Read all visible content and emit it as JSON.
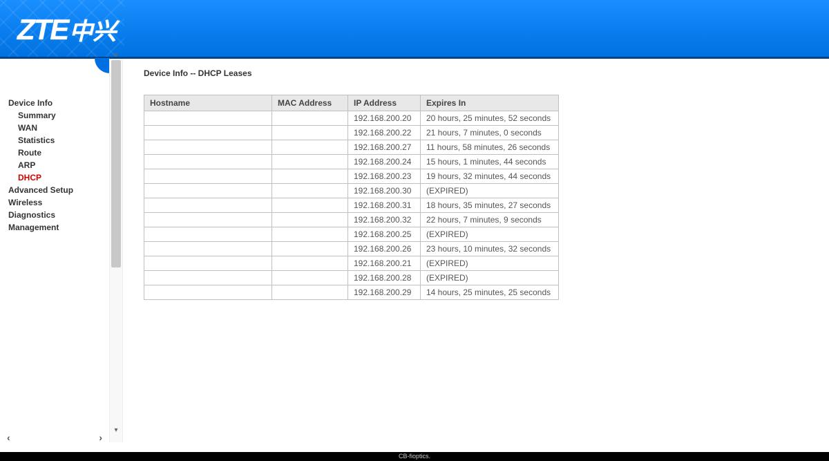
{
  "brand": {
    "logo_en": "ZTE",
    "logo_cn": "中兴"
  },
  "nav": {
    "items": [
      {
        "label": "Device Info",
        "sub": false,
        "active": false
      },
      {
        "label": "Summary",
        "sub": true,
        "active": false
      },
      {
        "label": "WAN",
        "sub": true,
        "active": false
      },
      {
        "label": "Statistics",
        "sub": true,
        "active": false
      },
      {
        "label": "Route",
        "sub": true,
        "active": false
      },
      {
        "label": "ARP",
        "sub": true,
        "active": false
      },
      {
        "label": "DHCP",
        "sub": true,
        "active": true
      },
      {
        "label": "Advanced Setup",
        "sub": false,
        "active": false
      },
      {
        "label": "Wireless",
        "sub": false,
        "active": false
      },
      {
        "label": "Diagnostics",
        "sub": false,
        "active": false
      },
      {
        "label": "Management",
        "sub": false,
        "active": false
      }
    ]
  },
  "page": {
    "title": "Device Info -- DHCP Leases"
  },
  "table": {
    "headers": {
      "hostname": "Hostname",
      "mac": "MAC Address",
      "ip": "IP Address",
      "expires": "Expires In"
    },
    "rows": [
      {
        "hostname": "",
        "mac": "",
        "ip": "192.168.200.20",
        "expires": "20 hours, 25 minutes, 52 seconds"
      },
      {
        "hostname": "",
        "mac": "",
        "ip": "192.168.200.22",
        "expires": "21 hours, 7 minutes, 0 seconds"
      },
      {
        "hostname": "",
        "mac": "",
        "ip": "192.168.200.27",
        "expires": "11 hours, 58 minutes, 26 seconds"
      },
      {
        "hostname": "",
        "mac": "",
        "ip": "192.168.200.24",
        "expires": "15 hours, 1 minutes, 44 seconds"
      },
      {
        "hostname": "",
        "mac": "",
        "ip": "192.168.200.23",
        "expires": "19 hours, 32 minutes, 44 seconds"
      },
      {
        "hostname": "",
        "mac": "",
        "ip": "192.168.200.30",
        "expires": "(EXPIRED)"
      },
      {
        "hostname": "",
        "mac": "",
        "ip": "192.168.200.31",
        "expires": "18 hours, 35 minutes, 27 seconds"
      },
      {
        "hostname": "",
        "mac": "",
        "ip": "192.168.200.32",
        "expires": "22 hours, 7 minutes, 9 seconds"
      },
      {
        "hostname": "",
        "mac": "",
        "ip": "192.168.200.25",
        "expires": "(EXPIRED)"
      },
      {
        "hostname": "",
        "mac": "",
        "ip": "192.168.200.26",
        "expires": "23 hours, 10 minutes, 32 seconds"
      },
      {
        "hostname": "",
        "mac": "",
        "ip": "192.168.200.21",
        "expires": "(EXPIRED)"
      },
      {
        "hostname": "",
        "mac": "",
        "ip": "192.168.200.28",
        "expires": "(EXPIRED)"
      },
      {
        "hostname": "",
        "mac": "",
        "ip": "192.168.200.29",
        "expires": "14 hours, 25 minutes, 25 seconds"
      }
    ]
  },
  "footer": {
    "text": "CB-fioptics."
  }
}
